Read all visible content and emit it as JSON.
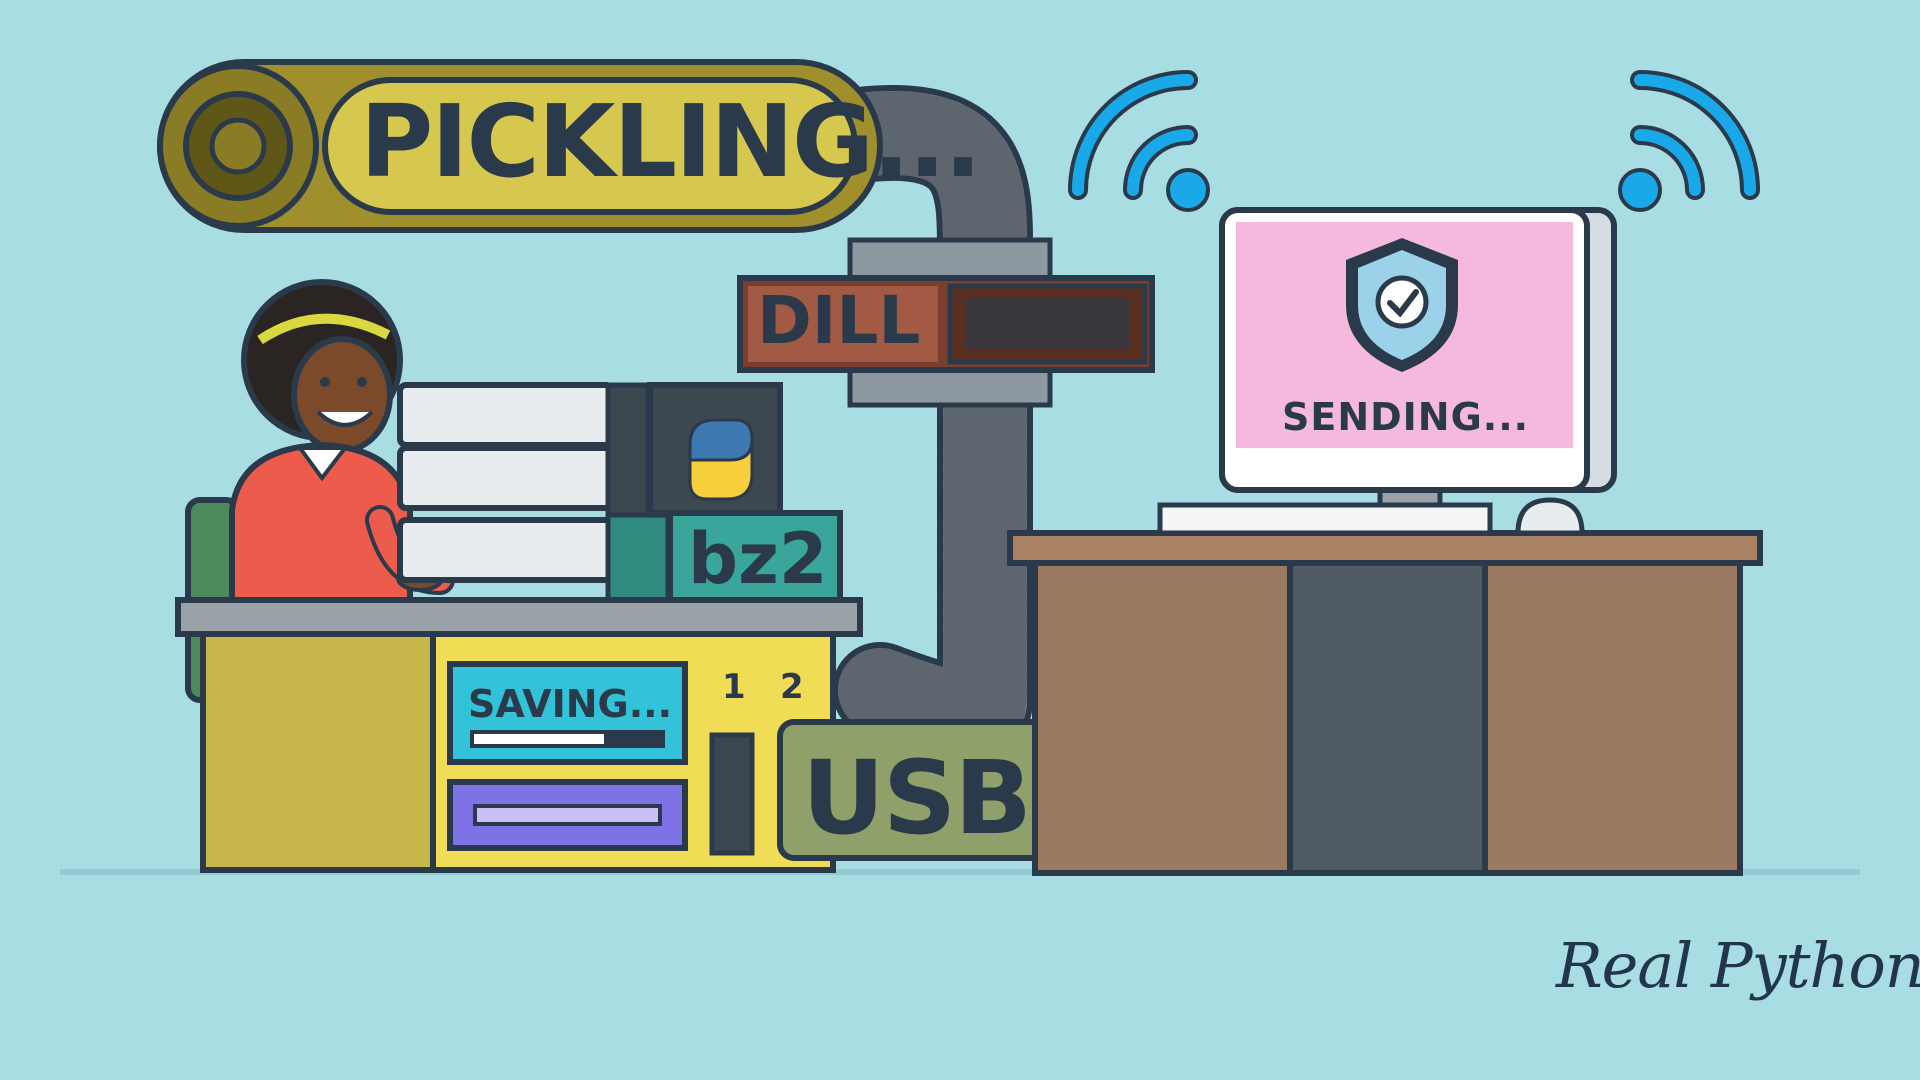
{
  "labels": {
    "pickling": "PICKLING...",
    "dill": "DILL",
    "bz2": "bz2",
    "saving": "SAVING...",
    "slot_one": "1",
    "slot_two": "2",
    "usb": "USB",
    "sending": "SENDING...",
    "brand": "Real Python"
  },
  "colors": {
    "background": "#a7dde3",
    "outline": "#2b3a4a",
    "pickling_tank": "#b7aa3e",
    "dill_box": "#8a4a37",
    "desk_yellow": "#f0dc55",
    "server_teal": "#3aa59b",
    "usb_green": "#8fa06a",
    "monitor_screen": "#f4b9dc",
    "wifi_blue": "#1aa9e8",
    "shirt_red": "#ec5b4b",
    "wood_desk": "#a88262"
  },
  "icons": {
    "wifi": "wifi-icon",
    "shield": "shield-check-icon",
    "python": "python-logo-icon"
  }
}
